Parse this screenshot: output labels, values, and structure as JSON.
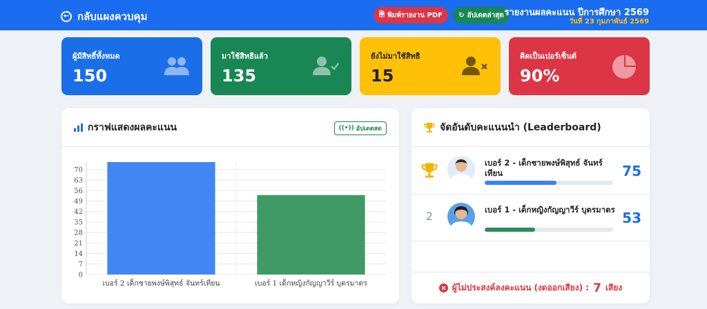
{
  "header": {
    "back_label": "กลับแผงควบคุม",
    "pdf_button": "พิมพ์รายงาน PDF",
    "update_button": "อัปเดตล่าสุด",
    "report_title": "รายงานผลคะแนน ปีการศึกษา 2569",
    "report_date": "วันที่ 23 กุมภาพันธ์ 2569"
  },
  "stats": [
    {
      "label": "ผู้มีสิทธิ์ทั้งหมด",
      "value": "150",
      "icon": "users-icon"
    },
    {
      "label": "มาใช้สิทธิแล้ว",
      "value": "135",
      "icon": "user-check-icon"
    },
    {
      "label": "ยังไม่มาใช้สิทธิ",
      "value": "15",
      "icon": "user-x-icon"
    },
    {
      "label": "คิดเป็นเปอร์เซ็นต์",
      "value": "90%",
      "icon": "pie-chart-icon"
    }
  ],
  "chart_panel": {
    "title": "กราฟแสดงผลคะแนน",
    "live_badge": "อัปเดตสด"
  },
  "chart_data": {
    "type": "bar",
    "categories": [
      "เบอร์ 2 เด็กชายพงษ์พิสุทธ์ จันทร์เทียน",
      "เบอร์ 1 เด็กหญิงกัญญาวีร์ บุตรมาตร"
    ],
    "values": [
      75,
      53
    ],
    "colors": [
      "#4286f4",
      "#3f9a66"
    ],
    "ylim": [
      0,
      75
    ],
    "yticks": [
      0,
      7,
      14,
      21,
      28,
      35,
      42,
      49,
      56,
      63,
      70
    ],
    "xlabel": "",
    "ylabel": ""
  },
  "leaderboard": {
    "title": "จัดอันดับคะแนนนำ (Leaderboard)",
    "entries": [
      {
        "rank": "",
        "name": "เบอร์ 2 - เด็กชายพงษ์พิสุทธ์ จันทร์เทียน",
        "score": "75",
        "progress": 0.56,
        "bar_color": "#3b82f6"
      },
      {
        "rank": "2",
        "name": "เบอร์ 1 - เด็กหญิงกัญญาวีร์ บุตรมาตร",
        "score": "53",
        "progress": 0.39,
        "bar_color": "#2e8b57"
      }
    ],
    "footer_label": "ผู้ไม่ประสงค์ลงคะแนน (งดออกเสียง) :",
    "footer_count": "7",
    "footer_unit": "เสียง"
  }
}
